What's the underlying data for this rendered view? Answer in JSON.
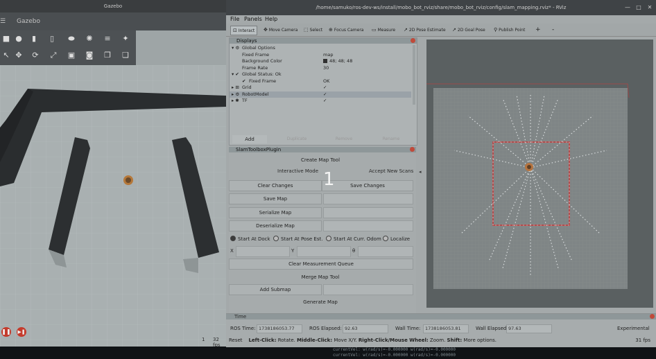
{
  "gazebo": {
    "title": "Gazebo",
    "menu_label": "Gazebo",
    "menu_icon": "hamburger-icon",
    "play_icon": "pause-icon",
    "step_icon": "step-icon",
    "bottom_num": "1",
    "bottom_rt": "32 fps",
    "toolbar_icons": [
      "box-icon",
      "sphere-icon",
      "cylinder-icon",
      "capsule-icon",
      "ellipsoid-icon",
      "sun-icon",
      "lines-icon",
      "lamp-icon",
      "select-icon",
      "translate-icon",
      "rotate-icon",
      "scale-icon",
      "align-icon",
      "camera-icon",
      "copy-icon",
      "paste-icon"
    ]
  },
  "terminal": {
    "lines": [
      "currentVel:     w(rad/s)=-0.000000 w(rad/s)=-0.000000",
      "currentVel:     w(rad/s)=-0.000000 w(rad/s)=-0.000000"
    ]
  },
  "rviz": {
    "title": "/home/samuko/ros-dev-ws/install/mobo_bot_rviz/share/mobo_bot_rviz/config/slam_mapping.rviz* - RViz",
    "menu": [
      "File",
      "Panels",
      "Help"
    ],
    "tools": [
      {
        "label": "Interact",
        "icon": "interact-icon",
        "active": true
      },
      {
        "label": "Move Camera",
        "icon": "move-camera-icon",
        "active": false
      },
      {
        "label": "Select",
        "icon": "select-icon",
        "active": false
      },
      {
        "label": "Focus Camera",
        "icon": "focus-camera-icon",
        "active": false
      },
      {
        "label": "Measure",
        "icon": "measure-icon",
        "active": false
      },
      {
        "label": "2D Pose Estimate",
        "icon": "pose-estimate-icon",
        "active": false
      },
      {
        "label": "2D Goal Pose",
        "icon": "goal-pose-icon",
        "active": false
      },
      {
        "label": "Publish Point",
        "icon": "publish-point-icon",
        "active": false
      },
      {
        "label": "+",
        "icon": "plus-icon",
        "active": false
      },
      {
        "label": "-",
        "icon": "minus-icon",
        "active": false
      }
    ],
    "displays": {
      "title": "Displays",
      "rows": [
        {
          "key": "Global Options",
          "value": "",
          "indent": 0,
          "prefix": "▾ ⚙"
        },
        {
          "key": "Fixed Frame",
          "value": "map",
          "indent": 1,
          "prefix": ""
        },
        {
          "key": "Background Color",
          "value": "48; 48; 48",
          "indent": 1,
          "prefix": "",
          "swatch": "#303030"
        },
        {
          "key": "Frame Rate",
          "value": "30",
          "indent": 1,
          "prefix": ""
        },
        {
          "key": "Global Status: Ok",
          "value": "",
          "indent": 0,
          "prefix": "▾ ✔"
        },
        {
          "key": "Fixed Frame",
          "value": "OK",
          "indent": 1,
          "prefix": "✔"
        },
        {
          "key": "Grid",
          "value": "✓",
          "indent": 0,
          "prefix": "▸ ⊞"
        },
        {
          "key": "RobotModel",
          "value": "✓",
          "indent": 0,
          "prefix": "▸ ⚙",
          "selected": true
        },
        {
          "key": "TF",
          "value": "✓",
          "indent": 0,
          "prefix": "▸ ✱"
        }
      ],
      "add_label": "Add",
      "disabled_buttons": [
        "Duplicate",
        "Remove",
        "Rename"
      ]
    },
    "slam": {
      "title": "SlamToolboxPlugin",
      "create_map": "Create Map Tool",
      "interactive_mode": "Interactive Mode",
      "accept_new_scans": "Accept New Scans",
      "clear_changes": "Clear Changes",
      "save_changes": "Save Changes",
      "save_map": "Save Map",
      "serialize_map": "Serialize Map",
      "deserialize_map": "Deserialize Map",
      "radios": [
        {
          "label": "Start At Dock",
          "checked": true
        },
        {
          "label": "Start At Pose Est.",
          "checked": false
        },
        {
          "label": "Start At Curr. Odom",
          "checked": false
        },
        {
          "label": "Localize",
          "checked": false
        }
      ],
      "x_label": "X",
      "y_label": "Y",
      "theta_label": "θ",
      "clear_queue": "Clear Measurement Queue",
      "merge_map": "Merge Map Tool",
      "add_submap": "Add Submap",
      "generate_map": "Generate Map"
    },
    "overlay_number": "1",
    "time": {
      "title": "Time",
      "ros_time_label": "ROS Time:",
      "ros_time": "1738186053.77",
      "ros_elapsed_label": "ROS Elapsed:",
      "ros_elapsed": "92.63",
      "wall_time_label": "Wall Time:",
      "wall_time": "1738186053.81",
      "wall_elapsed_label": "Wall Elapsed:",
      "wall_elapsed": "97.63",
      "experimental": "Experimental"
    },
    "status": {
      "reset": "Reset",
      "left_click": "Left-Click:",
      "left_action": "Rotate.",
      "middle_click": "Middle-Click:",
      "middle_action": "Move X/Y.",
      "right_click": "Right-Click/Mouse Wheel:",
      "right_action": "Zoom.",
      "shift": "Shift:",
      "shift_action": "More options.",
      "fps": "31 fps"
    }
  }
}
